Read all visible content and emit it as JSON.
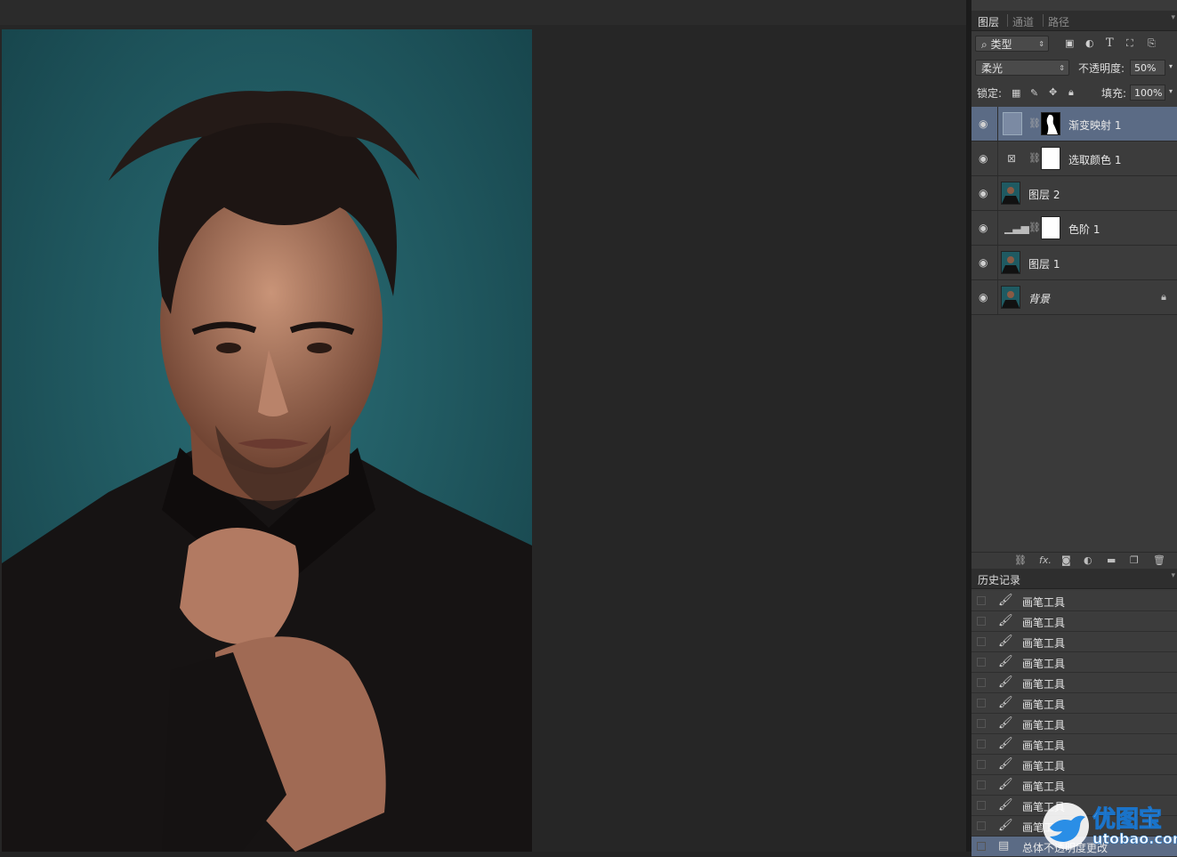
{
  "layers_panel": {
    "tabs": [
      "图层",
      "通道",
      "路径"
    ],
    "filter_kind": "类型",
    "blend_mode": "柔光",
    "opacity_label": "不透明度:",
    "opacity_value": "50%",
    "lock_label": "锁定:",
    "fill_label": "填充:",
    "fill_value": "100%",
    "layers": [
      {
        "name": "渐变映射 1",
        "type": "adjustment",
        "selected": true,
        "mask": "black-silhouette"
      },
      {
        "name": "选取颜色 1",
        "type": "adjustment",
        "selected": false,
        "mask": "white"
      },
      {
        "name": "图层 2",
        "type": "pixel",
        "selected": false
      },
      {
        "name": "色阶 1",
        "type": "adjustment",
        "selected": false,
        "mask": "white"
      },
      {
        "name": "图层 1",
        "type": "pixel",
        "selected": false
      },
      {
        "name": "背景",
        "type": "background",
        "selected": false,
        "locked": true
      }
    ]
  },
  "history_panel": {
    "title": "历史记录",
    "items": [
      "画笔工具",
      "画笔工具",
      "画笔工具",
      "画笔工具",
      "画笔工具",
      "画笔工具",
      "画笔工具",
      "画笔工具",
      "画笔工具",
      "画笔工具",
      "画笔工具",
      "画笔工具"
    ],
    "last_item_partial": "总体不透明度更改"
  },
  "watermark": {
    "title": "优图宝",
    "url": "utobao.com"
  },
  "colors": {
    "canvas_bg": "#1f5a62",
    "selection": "#5b6b85",
    "panel": "#3a3a3a"
  }
}
